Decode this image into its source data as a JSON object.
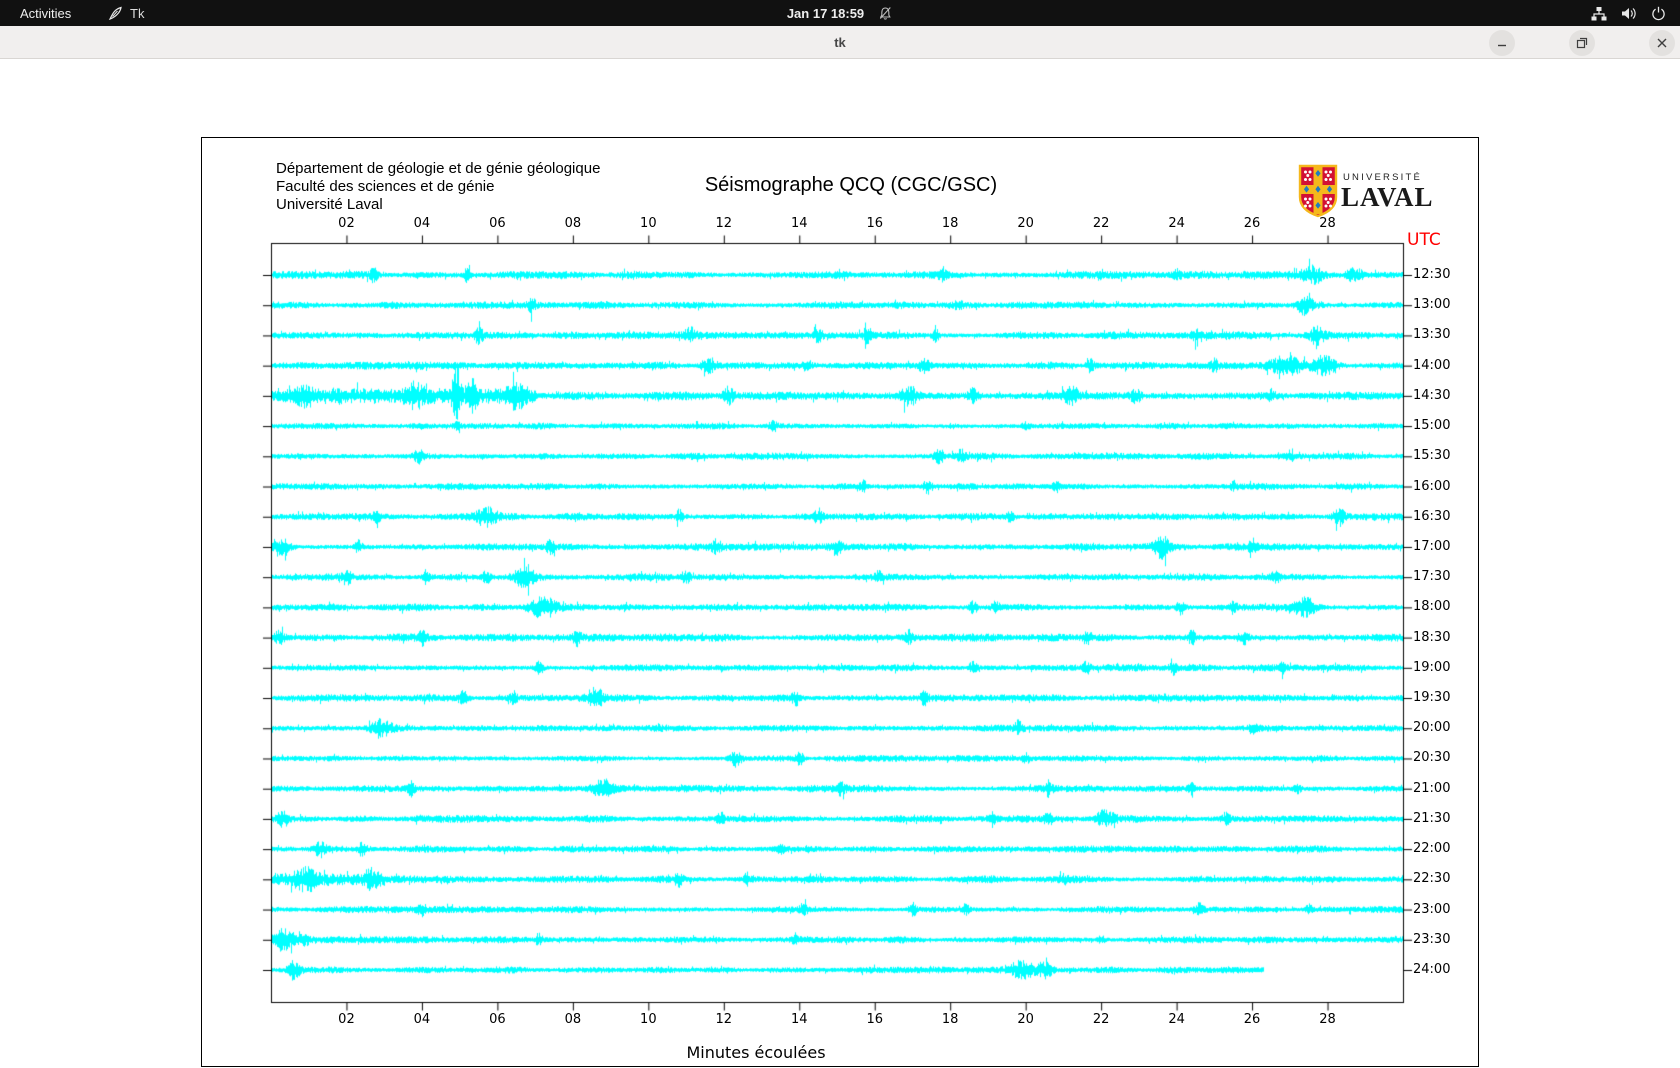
{
  "topbar": {
    "activities_label": "Activities",
    "app_indicator_label": "Tk",
    "clock": "Jan 17 18:59",
    "icons": [
      "tk-feather-icon",
      "notifications-disabled-icon",
      "network-icon",
      "volume-icon",
      "power-icon"
    ]
  },
  "titlebar": {
    "title": "tk",
    "buttons": [
      "minimize",
      "maximize",
      "close"
    ]
  },
  "logo": {
    "line1": "UNIVERSITÉ",
    "line2": "LAVAL",
    "shield_red": "#d21034",
    "shield_gold": "#f5b81c",
    "shield_blue": "#1f7bc0"
  },
  "chart_data": {
    "type": "line",
    "title": "Séismographe QCQ (CGC/GSC)",
    "header_lines": [
      "Département de géologie et de génie géologique",
      "Faculté des sciences et de génie",
      "Université Laval"
    ],
    "xlabel": "Minutes écoulées",
    "right_axis_label": "UTC",
    "x_range_minutes": [
      0,
      30
    ],
    "x_tick_minutes": [
      2,
      4,
      6,
      8,
      10,
      12,
      14,
      16,
      18,
      20,
      22,
      24,
      26,
      28
    ],
    "x_ticks": [
      "02",
      "04",
      "06",
      "08",
      "10",
      "12",
      "14",
      "16",
      "18",
      "20",
      "22",
      "24",
      "26",
      "28"
    ],
    "trace_color": "#00ffff",
    "axis_color": "#000000",
    "utc_label_color": "#ff0000",
    "grid": false,
    "rows": [
      {
        "time": "12:30",
        "end": 30,
        "base": 2.8,
        "bursts": [
          [
            2.7,
            6,
            0.1
          ],
          [
            5.2,
            7,
            0.08
          ],
          [
            17.8,
            7,
            0.1
          ],
          [
            24.0,
            4,
            0.1
          ],
          [
            27.6,
            8,
            0.3
          ],
          [
            28.7,
            6,
            0.2
          ]
        ]
      },
      {
        "time": "13:00",
        "end": 30,
        "base": 2.5,
        "bursts": [
          [
            6.9,
            7,
            0.1
          ],
          [
            18.2,
            4,
            0.1
          ],
          [
            27.4,
            9,
            0.25
          ]
        ]
      },
      {
        "time": "13:30",
        "end": 30,
        "base": 2.6,
        "bursts": [
          [
            5.5,
            8,
            0.1
          ],
          [
            11.1,
            6,
            0.15
          ],
          [
            14.5,
            6,
            0.1
          ],
          [
            15.8,
            6,
            0.1
          ],
          [
            17.6,
            6,
            0.1
          ],
          [
            24.5,
            5,
            0.1
          ],
          [
            27.7,
            7,
            0.2
          ]
        ]
      },
      {
        "time": "14:00",
        "end": 30,
        "base": 2.6,
        "bursts": [
          [
            11.6,
            7,
            0.2
          ],
          [
            14.2,
            5,
            0.1
          ],
          [
            17.3,
            6,
            0.15
          ],
          [
            21.7,
            6,
            0.1
          ],
          [
            25.0,
            5,
            0.1
          ],
          [
            26.9,
            9,
            0.45
          ],
          [
            27.9,
            8,
            0.3
          ]
        ]
      },
      {
        "time": "14:30",
        "end": 30,
        "base": 3.0,
        "extra": [
          0,
          7,
          4
        ],
        "bursts": [
          [
            0.9,
            7,
            0.2
          ],
          [
            3.8,
            9,
            0.2
          ],
          [
            4.9,
            30,
            0.1
          ],
          [
            5.3,
            12,
            0.15
          ],
          [
            6.5,
            9,
            0.25
          ],
          [
            12.1,
            8,
            0.15
          ],
          [
            16.9,
            9,
            0.2
          ],
          [
            18.6,
            6,
            0.15
          ],
          [
            21.2,
            8,
            0.2
          ],
          [
            22.9,
            7,
            0.15
          ],
          [
            26.5,
            5,
            0.1
          ]
        ]
      },
      {
        "time": "15:00",
        "end": 30,
        "base": 2.2,
        "bursts": [
          [
            4.9,
            4,
            0.1
          ],
          [
            13.3,
            5,
            0.1
          ],
          [
            20.0,
            3,
            0.1
          ]
        ]
      },
      {
        "time": "15:30",
        "end": 30,
        "base": 2.4,
        "bursts": [
          [
            3.9,
            6,
            0.1
          ],
          [
            17.7,
            6,
            0.12
          ],
          [
            18.3,
            5,
            0.1
          ],
          [
            27.0,
            4,
            0.1
          ]
        ]
      },
      {
        "time": "16:00",
        "end": 30,
        "base": 2.4,
        "bursts": [
          [
            15.7,
            6,
            0.1
          ],
          [
            17.4,
            7,
            0.12
          ],
          [
            20.8,
            5,
            0.1
          ],
          [
            25.5,
            4,
            0.1
          ]
        ]
      },
      {
        "time": "16:30",
        "end": 30,
        "base": 2.6,
        "bursts": [
          [
            2.8,
            5,
            0.1
          ],
          [
            5.7,
            7,
            0.3
          ],
          [
            10.8,
            6,
            0.1
          ],
          [
            14.5,
            6,
            0.1
          ],
          [
            19.6,
            5,
            0.1
          ],
          [
            28.3,
            8,
            0.15
          ]
        ]
      },
      {
        "time": "17:00",
        "end": 30,
        "base": 2.8,
        "bursts": [
          [
            0.3,
            7,
            0.2
          ],
          [
            2.3,
            6,
            0.1
          ],
          [
            7.4,
            6,
            0.1
          ],
          [
            11.8,
            6,
            0.1
          ],
          [
            15.0,
            5,
            0.1
          ],
          [
            23.6,
            9,
            0.2
          ],
          [
            26.0,
            6,
            0.1
          ]
        ]
      },
      {
        "time": "17:30",
        "end": 30,
        "base": 2.5,
        "bursts": [
          [
            2.0,
            7,
            0.12
          ],
          [
            4.1,
            6,
            0.1
          ],
          [
            5.7,
            6,
            0.1
          ],
          [
            6.7,
            9,
            0.3
          ],
          [
            11.0,
            6,
            0.1
          ],
          [
            16.1,
            5,
            0.1
          ],
          [
            26.6,
            5,
            0.1
          ]
        ]
      },
      {
        "time": "18:00",
        "end": 30,
        "base": 2.6,
        "bursts": [
          [
            7.2,
            10,
            0.35
          ],
          [
            18.6,
            6,
            0.1
          ],
          [
            19.2,
            5,
            0.1
          ],
          [
            24.1,
            6,
            0.1
          ],
          [
            25.5,
            5,
            0.1
          ],
          [
            27.4,
            8,
            0.3
          ]
        ]
      },
      {
        "time": "18:30",
        "end": 30,
        "base": 2.7,
        "bursts": [
          [
            0.2,
            6,
            0.15
          ],
          [
            4.0,
            6,
            0.1
          ],
          [
            8.1,
            6,
            0.1
          ],
          [
            16.9,
            6,
            0.1
          ],
          [
            21.6,
            6,
            0.1
          ],
          [
            24.4,
            6,
            0.1
          ],
          [
            25.8,
            6,
            0.1
          ]
        ]
      },
      {
        "time": "19:00",
        "end": 30,
        "base": 2.5,
        "bursts": [
          [
            7.1,
            6,
            0.1
          ],
          [
            18.6,
            6,
            0.1
          ],
          [
            21.6,
            5,
            0.1
          ],
          [
            23.9,
            5,
            0.1
          ],
          [
            26.8,
            4,
            0.1
          ]
        ]
      },
      {
        "time": "19:30",
        "end": 30,
        "base": 2.5,
        "bursts": [
          [
            5.1,
            6,
            0.1
          ],
          [
            6.4,
            6,
            0.1
          ],
          [
            8.6,
            9,
            0.2
          ],
          [
            13.9,
            6,
            0.1
          ],
          [
            17.3,
            6,
            0.1
          ]
        ]
      },
      {
        "time": "20:00",
        "end": 30,
        "base": 2.4,
        "bursts": [
          [
            2.9,
            8,
            0.25
          ],
          [
            19.8,
            6,
            0.1
          ],
          [
            26.0,
            4,
            0.1
          ]
        ]
      },
      {
        "time": "20:30",
        "end": 30,
        "base": 2.2,
        "bursts": [
          [
            12.3,
            7,
            0.15
          ],
          [
            14.0,
            6,
            0.1
          ],
          [
            20.0,
            4,
            0.1
          ]
        ]
      },
      {
        "time": "21:00",
        "end": 30,
        "base": 2.5,
        "bursts": [
          [
            3.7,
            6,
            0.1
          ],
          [
            8.8,
            8,
            0.3
          ],
          [
            15.1,
            5,
            0.1
          ],
          [
            20.6,
            6,
            0.1
          ],
          [
            24.4,
            5,
            0.1
          ],
          [
            27.2,
            4,
            0.1
          ]
        ]
      },
      {
        "time": "21:30",
        "end": 30,
        "base": 2.5,
        "bursts": [
          [
            0.3,
            7,
            0.15
          ],
          [
            11.9,
            6,
            0.1
          ],
          [
            19.1,
            6,
            0.1
          ],
          [
            20.6,
            5,
            0.1
          ],
          [
            22.1,
            7,
            0.25
          ],
          [
            25.3,
            5,
            0.1
          ]
        ]
      },
      {
        "time": "22:00",
        "end": 30,
        "base": 2.3,
        "bursts": [
          [
            1.3,
            7,
            0.15
          ],
          [
            2.4,
            6,
            0.1
          ],
          [
            13.5,
            3,
            0.1
          ]
        ]
      },
      {
        "time": "22:30",
        "end": 30,
        "base": 2.5,
        "extra": [
          0,
          3,
          4
        ],
        "bursts": [
          [
            0.9,
            8,
            0.3
          ],
          [
            2.6,
            7,
            0.2
          ],
          [
            10.8,
            6,
            0.1
          ],
          [
            12.6,
            5,
            0.1
          ],
          [
            21.0,
            3,
            0.1
          ]
        ]
      },
      {
        "time": "23:00",
        "end": 30,
        "base": 2.3,
        "bursts": [
          [
            4.0,
            6,
            0.1
          ],
          [
            14.1,
            6,
            0.1
          ],
          [
            17.0,
            6,
            0.1
          ],
          [
            18.4,
            5,
            0.1
          ],
          [
            24.6,
            5,
            0.1
          ],
          [
            27.5,
            4,
            0.1
          ]
        ]
      },
      {
        "time": "23:30",
        "end": 30,
        "base": 2.4,
        "extra": [
          0,
          1,
          4
        ],
        "bursts": [
          [
            0.3,
            7,
            0.2
          ],
          [
            7.1,
            6,
            0.1
          ],
          [
            13.9,
            5,
            0.1
          ],
          [
            22.0,
            3,
            0.1
          ]
        ]
      },
      {
        "time": "24:00",
        "end": 26.3,
        "base": 2.3,
        "bursts": [
          [
            0.6,
            9,
            0.15
          ],
          [
            19.9,
            8,
            0.3
          ],
          [
            20.5,
            7,
            0.2
          ]
        ]
      }
    ]
  }
}
